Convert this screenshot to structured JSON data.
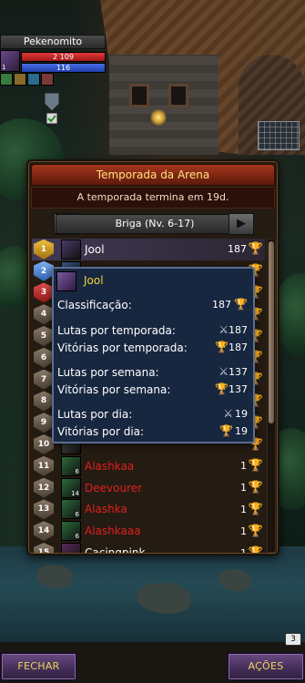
{
  "player": {
    "name": "Pekenomito",
    "level": "1",
    "hp": "2 109",
    "mp": "116"
  },
  "arena": {
    "title": "Temporada da Arena",
    "season_notice": "A temporada termina em 19d.",
    "league": "Briga (Nv. 6-17)",
    "rows": [
      {
        "rank": "1",
        "name": "Jool",
        "score": "187",
        "color": "white",
        "level": ""
      },
      {
        "rank": "2",
        "name": "",
        "score": "",
        "color": "white",
        "level": ""
      },
      {
        "rank": "3",
        "name": "",
        "score": "",
        "color": "white",
        "level": ""
      },
      {
        "rank": "4",
        "name": "",
        "score": "",
        "color": "white",
        "level": ""
      },
      {
        "rank": "5",
        "name": "",
        "score": "",
        "color": "white",
        "level": ""
      },
      {
        "rank": "6",
        "name": "",
        "score": "",
        "color": "white",
        "level": ""
      },
      {
        "rank": "7",
        "name": "",
        "score": "",
        "color": "white",
        "level": ""
      },
      {
        "rank": "8",
        "name": "",
        "score": "",
        "color": "white",
        "level": ""
      },
      {
        "rank": "9",
        "name": "",
        "score": "",
        "color": "white",
        "level": ""
      },
      {
        "rank": "10",
        "name": "",
        "score": "",
        "color": "white",
        "level": ""
      },
      {
        "rank": "11",
        "name": "Alashkaa",
        "score": "1",
        "color": "red",
        "level": "6"
      },
      {
        "rank": "12",
        "name": "Deevourer",
        "score": "1",
        "color": "red",
        "level": "14"
      },
      {
        "rank": "13",
        "name": "Alashka",
        "score": "1",
        "color": "red",
        "level": "6"
      },
      {
        "rank": "14",
        "name": "Alashkaaa",
        "score": "1",
        "color": "red",
        "level": "6"
      },
      {
        "rank": "15",
        "name": "Cacingpink",
        "score": "1",
        "color": "white",
        "level": "12"
      }
    ]
  },
  "popup": {
    "name": "Jool",
    "classification_label": "Classificação:",
    "classification_value": "187",
    "season_fights_label": "Lutas por temporada:",
    "season_fights_value": "187",
    "season_wins_label": "Vitórias por temporada:",
    "season_wins_value": "187",
    "week_fights_label": "Lutas por semana:",
    "week_fights_value": "137",
    "week_wins_label": "Vitórias por semana:",
    "week_wins_value": "137",
    "day_fights_label": "Lutas por dia:",
    "day_fights_value": "19",
    "day_wins_label": "Vitórias por dia:",
    "day_wins_value": "19"
  },
  "buttons": {
    "close": "FECHAR",
    "actions": "AÇÕES"
  },
  "badge": "3",
  "icons": {
    "trophy": "trophy-icon",
    "sword": "sword-icon",
    "arrow_left": "arrow-left-icon",
    "arrow_right": "arrow-right-icon"
  },
  "colors": {
    "title_bg": "#a4371e",
    "title_text": "#ffe27a",
    "popup_bg": "#182842",
    "popup_name": "#f2d23a",
    "button_text": "#f0d25a",
    "enemy_name": "#e02020"
  }
}
